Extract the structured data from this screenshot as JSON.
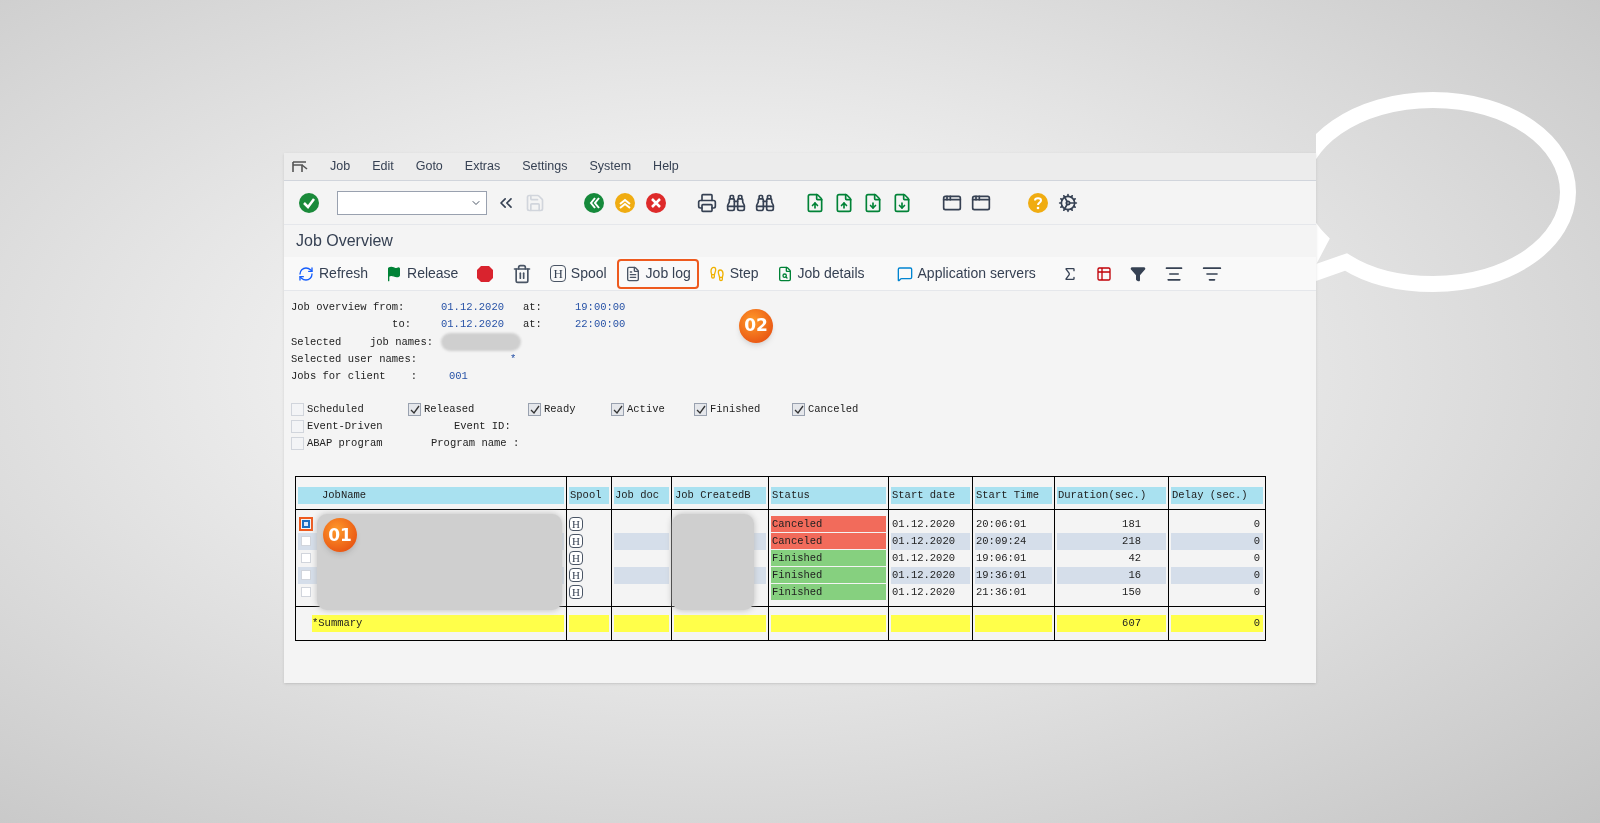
{
  "menu": [
    {
      "label": "Job"
    },
    {
      "label": "Edit"
    },
    {
      "label": "Goto"
    },
    {
      "label": "Extras"
    },
    {
      "label": "Settings"
    },
    {
      "label": "System"
    },
    {
      "label": "Help"
    }
  ],
  "title": "Job Overview",
  "app_toolbar": [
    {
      "kind": "refresh",
      "label": "Refresh",
      "highlighted": false
    },
    {
      "kind": "release",
      "label": "Release",
      "highlighted": false
    },
    {
      "kind": "stop",
      "highlighted": false
    },
    {
      "kind": "delete",
      "highlighted": false
    },
    {
      "kind": "spool",
      "icon_text": "H",
      "label": "Spool",
      "highlighted": false
    },
    {
      "kind": "joblog",
      "label": "Job log",
      "highlighted": true
    },
    {
      "kind": "step",
      "label": "Step",
      "highlighted": false
    },
    {
      "kind": "details",
      "label": "Job details",
      "highlighted": false
    },
    {
      "kind": "servers",
      "label": "Application servers",
      "highlighted": false
    },
    {
      "kind": "sum",
      "highlighted": false
    },
    {
      "kind": "layout",
      "highlighted": false
    },
    {
      "kind": "filter",
      "highlighted": false
    },
    {
      "kind": "center",
      "highlighted": false
    },
    {
      "kind": "sort",
      "highlighted": false
    }
  ],
  "criteria": {
    "from_label": "Job overview from:",
    "from_date": "01.12.2020",
    "from_at": "at:",
    "from_time": "19:00:00",
    "to_label": "to:",
    "to_date": "01.12.2020",
    "to_at": "at:",
    "to_time": "22:00:00",
    "selected_label": "Selected",
    "job_names_label": "job names:",
    "user_names_label": "Selected user names:",
    "user_names_value": "*",
    "client_label": "Jobs for client    :",
    "client_value": "001"
  },
  "status_filters": [
    {
      "label": "Scheduled",
      "checked": false
    },
    {
      "label": "Released",
      "checked": true
    },
    {
      "label": "Ready",
      "checked": true
    },
    {
      "label": "Active",
      "checked": true
    },
    {
      "label": "Finished",
      "checked": true
    },
    {
      "label": "Canceled",
      "checked": true
    }
  ],
  "other_filters": [
    {
      "label": "Event-Driven",
      "checked": false,
      "field_label": "Event ID:"
    },
    {
      "label": "ABAP program",
      "checked": false,
      "field_label": "Program name :"
    }
  ],
  "table": {
    "columns": [
      "JobName",
      "Spool",
      "Job doc",
      "Job CreatedB",
      "Status",
      "Start date",
      "Start Time",
      "Duration(sec.)",
      "Delay (sec.)"
    ],
    "rows": [
      {
        "selected": true,
        "spool": "H",
        "status": "Canceled",
        "color": "#f26b5b",
        "start_date": "01.12.2020",
        "start_time": "20:06:01",
        "duration": "181",
        "delay": "0"
      },
      {
        "selected": false,
        "spool": "H",
        "status": "Canceled",
        "color": "#f26b5b",
        "start_date": "01.12.2020",
        "start_time": "20:09:24",
        "duration": "218",
        "delay": "0"
      },
      {
        "selected": false,
        "spool": "H",
        "status": "Finished",
        "color": "#86d07f",
        "start_date": "01.12.2020",
        "start_time": "19:06:01",
        "duration": "42",
        "delay": "0"
      },
      {
        "selected": false,
        "spool": "H",
        "status": "Finished",
        "color": "#86d07f",
        "start_date": "01.12.2020",
        "start_time": "19:36:01",
        "duration": "16",
        "delay": "0"
      },
      {
        "selected": false,
        "spool": "H",
        "status": "Finished",
        "color": "#86d07f",
        "start_date": "01.12.2020",
        "start_time": "21:36:01",
        "duration": "150",
        "delay": "0"
      }
    ],
    "summary": {
      "label": "*Summary",
      "duration": "607",
      "delay": "0"
    }
  },
  "callouts": [
    {
      "text": "01"
    },
    {
      "text": "02"
    }
  ]
}
